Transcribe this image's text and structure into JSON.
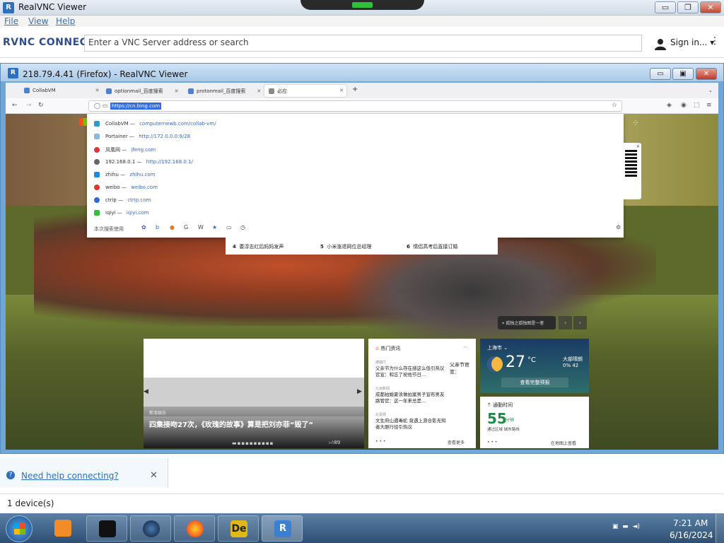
{
  "window": {
    "title": "RealVNC Viewer",
    "app_icon": "realvnc-icon",
    "min_label": "▭",
    "max_label": "❐",
    "close_label": "✕"
  },
  "menu": {
    "file": "File",
    "view": "View",
    "help": "Help"
  },
  "connect": {
    "logo": "RVNC CONNECT",
    "address_placeholder": "Enter a VNC Server address or search",
    "sign_in": "Sign in...",
    "sign_in_caret": "▾",
    "more": "⋮"
  },
  "session": {
    "title": "218.79.4.41 (Firefox) - RealVNC Viewer",
    "min_label": "▭",
    "max_label": "▣",
    "close_label": "✕"
  },
  "firefox": {
    "tabs": [
      {
        "label": "CollabVM"
      },
      {
        "label": "optionmail_百度搜索"
      },
      {
        "label": "protonmail_百度搜索"
      },
      {
        "label": "必应"
      }
    ],
    "new_tab": "+",
    "url_selected": "https://cn.bing.com",
    "dropdown": {
      "rows": [
        {
          "name": "CollabVM",
          "url": "computernewb.com/collab-vm/",
          "color": "#2e9ad0"
        },
        {
          "name": "Portainer",
          "url": "http://172.0.0.0:9/28",
          "color": "#8bb8e0"
        },
        {
          "name": "凤凰网",
          "url": "ifeng.com",
          "color": "#d9363e"
        },
        {
          "name": "192.168.0.1",
          "url": "http://192.168.0.1/",
          "color": "#666666"
        },
        {
          "name": "zhihu",
          "url": "zhihu.com",
          "color": "#1e8ae0"
        },
        {
          "name": "weibo",
          "url": "weibo.com",
          "color": "#e2332c"
        },
        {
          "name": "ctrip",
          "url": "ctrip.com",
          "color": "#2a6bd0"
        },
        {
          "name": "iqiyi",
          "url": "iqiyi.com",
          "color": "#2fbf3a"
        }
      ],
      "footer": "本次搜索使用"
    }
  },
  "page": {
    "trending": [
      {
        "num": "4",
        "text": "委淳志红后妈妈发声"
      },
      {
        "num": "5",
        "text": "小米涨退网位总经理"
      },
      {
        "num": "6",
        "text": "情侣高考后直接订婚"
      }
    ],
    "location": "孤独之孤独图是一者",
    "hero": {
      "source": "新浪娱乐",
      "title": "四集接吻27次，《玫瑰的故事》算是把刘亦菲“毁了”",
      "likes": "89"
    },
    "hot": {
      "heading": "热门资讯",
      "items": [
        {
          "source": "搜狐IT",
          "text": "父亲节为什么存在感这么低引热议 官宣：和忘了祝他节日..."
        },
        {
          "source": "九派新闻",
          "text": "成都拍婚夏读做拍案男子宣布男友路管官：这一年来总是..."
        },
        {
          "source": "北青网",
          "text": "文生府山遇毒蛇 竟遇上游合影无知者大胆行径引热议"
        }
      ],
      "side": "父亲节官宣：",
      "more": "查看更多"
    },
    "weather": {
      "city": "上海市",
      "temp": "27",
      "unit": "°C",
      "desc": "大部晴朗",
      "extra": "0%  42",
      "button": "查看完整预报"
    },
    "commute": {
      "label": "通勤时间",
      "value": "55",
      "unit": "分钟",
      "sub": "通过区域 城市路线",
      "more": "在地图上查看"
    }
  },
  "help": {
    "link": "Need help connecting?",
    "icon": "?",
    "close": "✕"
  },
  "status": {
    "devices": "1 device(s)"
  },
  "taskbar": {
    "items": [
      {
        "icon": "media-player-icon",
        "color": "#f28c28"
      },
      {
        "icon": "terminal-icon",
        "color": "#111111"
      },
      {
        "icon": "globe-icon",
        "color": "#1a3a66"
      },
      {
        "icon": "firefox-icon",
        "color": "#ff7a1a"
      },
      {
        "icon": "deskedit-icon",
        "color": "#e0b818"
      },
      {
        "icon": "realvnc-taskbar-icon",
        "color": "#3c7fd0"
      }
    ],
    "time": "7:21 AM",
    "date": "6/16/2024"
  }
}
